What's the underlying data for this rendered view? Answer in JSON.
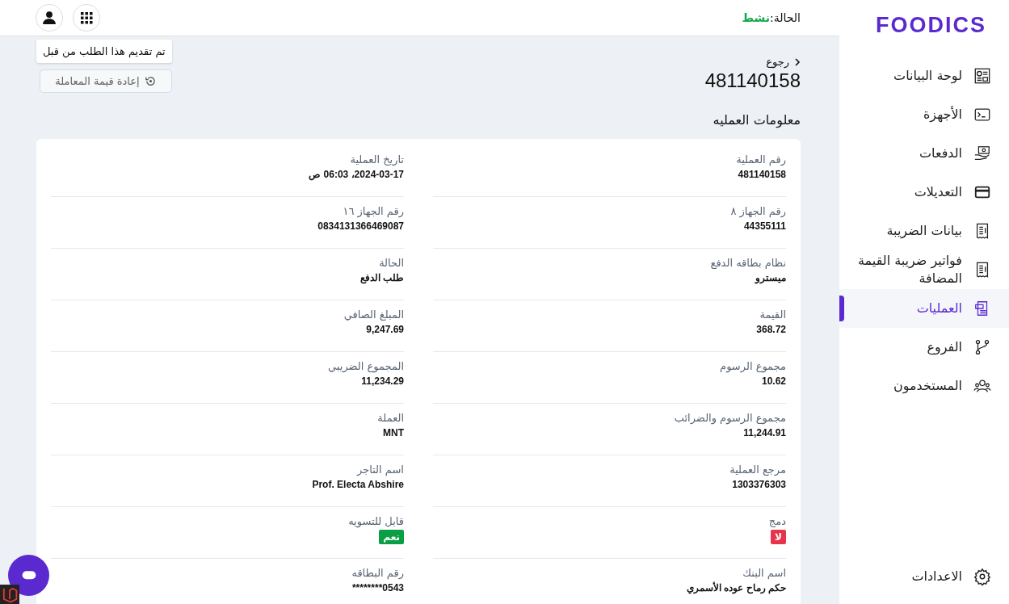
{
  "brand": {
    "logo": "FOODICS"
  },
  "topbar": {
    "status_label": "الحالة:",
    "status_value": "نشط"
  },
  "sidebar": {
    "items": [
      {
        "label": "لوحة البيانات",
        "selected": false
      },
      {
        "label": "الأجهزة",
        "selected": false
      },
      {
        "label": "الدفعات",
        "selected": false
      },
      {
        "label": "التعديلات",
        "selected": false
      },
      {
        "label": "بيانات الضريبة",
        "selected": false
      },
      {
        "label": "فواتير ضريبة القيمة المضافة",
        "selected": false
      },
      {
        "label": "العمليات",
        "selected": true
      },
      {
        "label": "الفروع",
        "selected": false
      },
      {
        "label": "المستخدمون",
        "selected": false
      }
    ],
    "settings": "الاعدادات"
  },
  "header": {
    "back": "رجوع",
    "title": "481140158",
    "section": "معلومات العمليه"
  },
  "notice": "تم تقديم هذا الطلب من قبل",
  "reset_button": "إعادة قيمة المعاملة",
  "fields": [
    {
      "label": "رقم العملية",
      "value": "481140158",
      "kind": "text"
    },
    {
      "label": "تاريخ العملية",
      "value": "2024-03-17، 06:03 ص",
      "kind": "text"
    },
    {
      "label": "رقم الجهاز ٨",
      "value": "44355111",
      "kind": "text"
    },
    {
      "label": "رقم الجهاز ١٦",
      "value": "0834131366469087",
      "kind": "text"
    },
    {
      "label": "نظام بطاقه الدفع",
      "value": "ميسترو",
      "kind": "text"
    },
    {
      "label": "الحالة",
      "value": "طلب الدفع",
      "kind": "text"
    },
    {
      "label": "القيمة",
      "value": "368.72",
      "kind": "text"
    },
    {
      "label": "المبلغ الصافي",
      "value": "9,247.69",
      "kind": "text"
    },
    {
      "label": "مجموع الرسوم",
      "value": "10.62",
      "kind": "text"
    },
    {
      "label": "المجموع الضريبي",
      "value": "11,234.29",
      "kind": "text"
    },
    {
      "label": "مجموع الرسوم والضرائب",
      "value": "11,244.91",
      "kind": "text"
    },
    {
      "label": "العملة",
      "value": "MNT",
      "kind": "text"
    },
    {
      "label": "مرجع العملية",
      "value": "1303376303",
      "kind": "text"
    },
    {
      "label": "اسم التاجر",
      "value": "Prof. Electa Abshire",
      "kind": "text"
    },
    {
      "label": "دمج",
      "value": "لا",
      "kind": "badge",
      "color": "#e8344a"
    },
    {
      "label": "قابل للتسويه",
      "value": "نعم",
      "kind": "badge",
      "color": "#0a9e45"
    },
    {
      "label": "اسم البنك",
      "value": "حكم رماح عوده الأسمري",
      "kind": "text"
    },
    {
      "label": "رقم البطاقه",
      "value": "********0543",
      "kind": "text"
    }
  ]
}
